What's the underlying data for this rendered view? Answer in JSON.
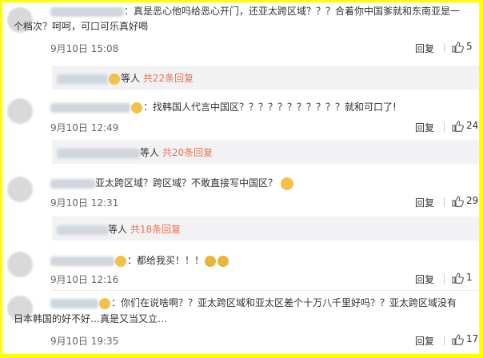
{
  "comments": [
    {
      "text_line1": "：真是恶心他吗给恶心开门，还亚太跨区域？？？合着你中国爹就和东南亚是一",
      "text_line2": "个档次？呵呵，可口可乐真好喝",
      "time": "9月10日 15:08",
      "reply_label": "回复",
      "likes": "5",
      "replies_mid": "等人",
      "replies_count": "共22条回复"
    },
    {
      "text_line1": "：找韩国人代言中国区？？？？？？？？？？？就和可口了!",
      "time": "9月10日 12:49",
      "reply_label": "回复",
      "likes": "24",
      "replies_mid": "等人",
      "replies_count": "共20条回复"
    },
    {
      "text_line1": "亚太跨区域？跨区域？不敢直接写中国区？",
      "time": "9月10日 12:31",
      "reply_label": "回复",
      "likes": "29",
      "replies_mid": "等人",
      "replies_count": "共18条回复"
    },
    {
      "text_line1": "：都给我买！！！",
      "time": "9月10日 12:16",
      "reply_label": "回复",
      "likes": "1"
    },
    {
      "text_line1": "：你们在说啥啊？？亚太跨区域和亚太区差个十万八千里好吗？？亚太跨区域没有",
      "text_line2": "日本韩国的好不好…真是又当又立…",
      "time": "9月10日 19:35",
      "reply_label": "回复",
      "likes": "17"
    }
  ],
  "colors": {
    "border": "#ffff00",
    "link": "#eb7350",
    "replies_bg": "#f2f2f5"
  }
}
